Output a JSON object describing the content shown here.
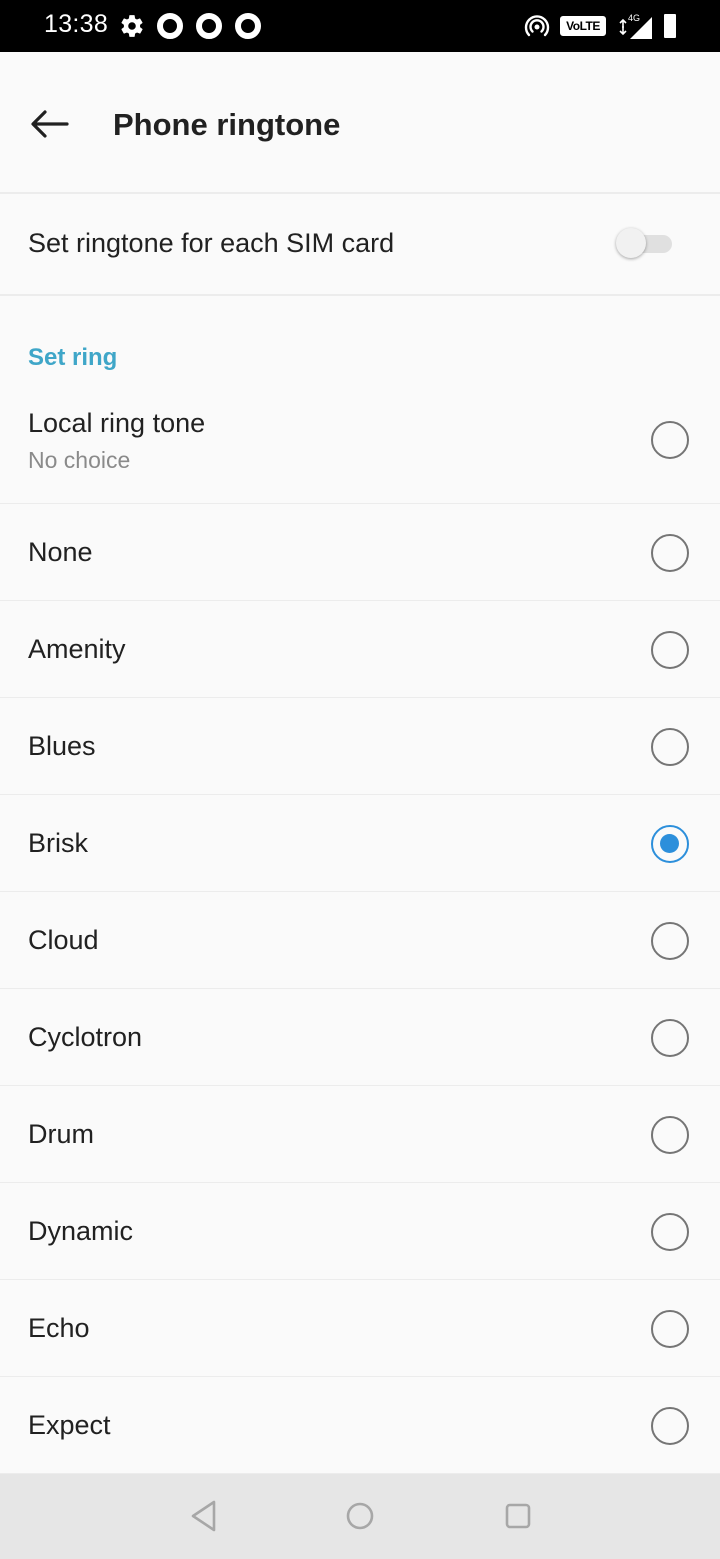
{
  "status_bar": {
    "time": "13:38",
    "icons": [
      "settings-gear-icon",
      "notification-ring-icon",
      "notification-ring-icon",
      "notification-ring-icon",
      "hotspot-icon",
      "volte-icon",
      "signal-icon",
      "battery-icon"
    ],
    "volte_label": "VoLTE",
    "network_label": "4G"
  },
  "app_bar": {
    "back_icon": "arrow-left-icon",
    "title": "Phone ringtone"
  },
  "sim_setting": {
    "label": "Set ringtone for each SIM card",
    "enabled": false
  },
  "section": {
    "header": "Set ring"
  },
  "ringtones": [
    {
      "label": "Local ring tone",
      "sublabel": "No choice",
      "selected": false
    },
    {
      "label": "None",
      "selected": false
    },
    {
      "label": "Amenity",
      "selected": false
    },
    {
      "label": "Blues",
      "selected": false
    },
    {
      "label": "Brisk",
      "selected": true
    },
    {
      "label": "Cloud",
      "selected": false
    },
    {
      "label": "Cyclotron",
      "selected": false
    },
    {
      "label": "Drum",
      "selected": false
    },
    {
      "label": "Dynamic",
      "selected": false
    },
    {
      "label": "Echo",
      "selected": false
    },
    {
      "label": "Expect",
      "selected": false
    }
  ],
  "nav_bar": {
    "icons": [
      "nav-back-icon",
      "nav-home-icon",
      "nav-recents-icon"
    ]
  },
  "colors": {
    "accent": "#2c8fdb",
    "section_header": "#3fa6c8",
    "background": "#fafafa",
    "status_bar": "#000000",
    "nav_bar": "#e6e6e6"
  }
}
